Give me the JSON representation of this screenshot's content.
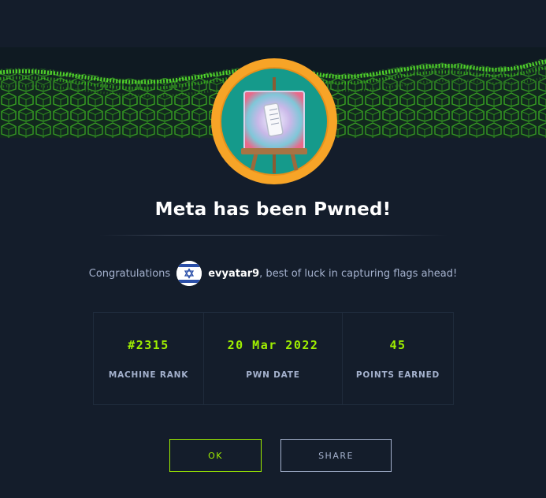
{
  "page": {
    "title": "Meta has been Pwned!",
    "congrats_prefix": "Congratulations",
    "username": "evyatar9",
    "congrats_suffix": ", best of luck in capturing flags ahead!"
  },
  "stats": [
    {
      "value": "#2315",
      "label": "MACHINE RANK"
    },
    {
      "value": "20 Mar 2022",
      "label": "PWN DATE"
    },
    {
      "value": "45",
      "label": "POINTS EARNED"
    }
  ],
  "buttons": {
    "ok_label": "OK",
    "share_label": "SHARE"
  },
  "icons": {
    "badge": "machine-badge-easel-icon",
    "flag": "israel-flag-icon"
  },
  "colors": {
    "background": "#141d2b",
    "accent": "#9fef00",
    "badge_ring": "#f7a427",
    "badge_inner": "#159a8b",
    "text_muted": "#a4b1cd"
  }
}
